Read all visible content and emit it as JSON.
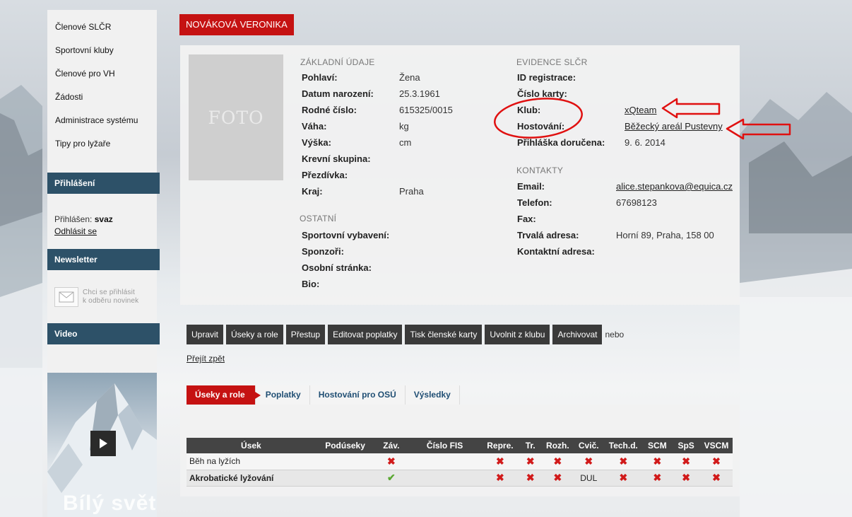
{
  "sidebar": {
    "nav": [
      "Členové SLČR",
      "Sportovní kluby",
      "Členové pro VH",
      "Žádosti",
      "Administrace systému",
      "Tipy pro lyžaře"
    ],
    "login_heading": "Přihlášení",
    "logged_in_label": "Přihlášen:",
    "logged_in_user": "svaz",
    "logout_link": "Odhlásit se",
    "newsletter_heading": "Newsletter",
    "newsletter_line1": "Chci se přihlásit",
    "newsletter_line2": "k odběru novinek",
    "video_heading": "Video",
    "video_title": "Bílý svět"
  },
  "profile": {
    "name": "NOVÁKOVÁ VERONIKA",
    "photo_placeholder": "FOTO",
    "basic": {
      "title": "ZÁKLADNÍ ÚDAJE",
      "rows": [
        {
          "label": "Pohlaví:",
          "value": "Žena"
        },
        {
          "label": "Datum narození:",
          "value": "25.3.1961"
        },
        {
          "label": "Rodné číslo:",
          "value": "615325/0015"
        },
        {
          "label": "Váha:",
          "value": "kg"
        },
        {
          "label": "Výška:",
          "value": "cm"
        },
        {
          "label": "Krevní skupina:",
          "value": ""
        },
        {
          "label": "Přezdívka:",
          "value": ""
        },
        {
          "label": "Kraj:",
          "value": "Praha"
        }
      ]
    },
    "other": {
      "title": "OSTATNÍ",
      "rows": [
        {
          "label": "Sportovní vybavení:"
        },
        {
          "label": "Sponzoři:"
        },
        {
          "label": "Osobní stránka:"
        },
        {
          "label": "Bio:"
        }
      ]
    },
    "evidence": {
      "title": "EVIDENCE SLČR",
      "id_label": "ID registrace:",
      "card_label": "Číslo karty:",
      "club_label": "Klub:",
      "club_value": "xQteam",
      "hosting_label": "Hostování:",
      "hosting_value": "Běžecký areál Pustevny",
      "application_label": "Přihláška doručena:",
      "application_value": "9. 6. 2014"
    },
    "contacts": {
      "title": "KONTAKTY",
      "email_label": "Email:",
      "email_value": "alice.stepankova@equica.cz",
      "phone_label": "Telefon:",
      "phone_value": "67698123",
      "fax_label": "Fax:",
      "address_label": "Trvalá adresa:",
      "address_value": "Horní 89, Praha, 158 00",
      "contact_address_label": "Kontaktní adresa:"
    }
  },
  "actions": {
    "buttons": [
      "Upravit",
      "Úseky a role",
      "Přestup",
      "Editovat poplatky",
      "Tisk členské karty",
      "Uvolnit z klubu",
      "Archivovat"
    ],
    "or_text": "nebo",
    "back_link": "Přejít zpět"
  },
  "tabs": [
    "Úseky a role",
    "Poplatky",
    "Hostování pro OSÚ",
    "Výsledky"
  ],
  "table": {
    "headers": [
      "Úsek",
      "Podúseky",
      "Záv.",
      "Číslo FIS",
      "Repre.",
      "Tr.",
      "Rozh.",
      "Cvič.",
      "Tech.d.",
      "SCM",
      "SpS",
      "VSCM"
    ],
    "rows": [
      {
        "usek": "Běh na lyžích",
        "bold": false,
        "podiseky": "",
        "zav": "x",
        "fis": "",
        "repre": "x",
        "tr": "x",
        "rozh": "x",
        "cvic": "x",
        "techd": "x",
        "scm": "x",
        "sps": "x",
        "vscm": "x"
      },
      {
        "usek": "Akrobatické lyžování",
        "bold": true,
        "podiseky": "",
        "zav": "check",
        "fis": "",
        "repre": "x",
        "tr": "x",
        "rozh": "x",
        "cvic": "DUL",
        "techd": "x",
        "scm": "x",
        "sps": "x",
        "vscm": "x"
      }
    ]
  },
  "colors": {
    "accent_red": "#c51212",
    "sidebar_head": "#2d5168",
    "button_dark": "#3a3a3a",
    "annotation_red": "#e01010"
  }
}
